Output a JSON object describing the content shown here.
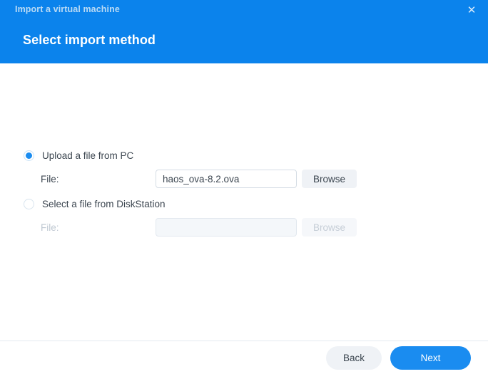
{
  "window": {
    "title": "Import a virtual machine",
    "close_icon": "close-icon",
    "close_glyph": "✕",
    "accent_color": "#0b83ec",
    "title_color": "#b9daf5"
  },
  "header": {
    "heading": "Select import method"
  },
  "options": [
    {
      "id": "upload-from-pc",
      "label": "Upload a file from PC",
      "selected": true,
      "file_label": "File:",
      "file_value": "haos_ova-8.2.ova",
      "file_placeholder": "",
      "browse_label": "Browse",
      "disabled": false
    },
    {
      "id": "select-from-diskstation",
      "label": "Select a file from DiskStation",
      "selected": false,
      "file_label": "File:",
      "file_value": "",
      "file_placeholder": "",
      "browse_label": "Browse",
      "disabled": true
    }
  ],
  "footer": {
    "back_label": "Back",
    "next_label": "Next",
    "next_color": "#1a8cf0"
  }
}
